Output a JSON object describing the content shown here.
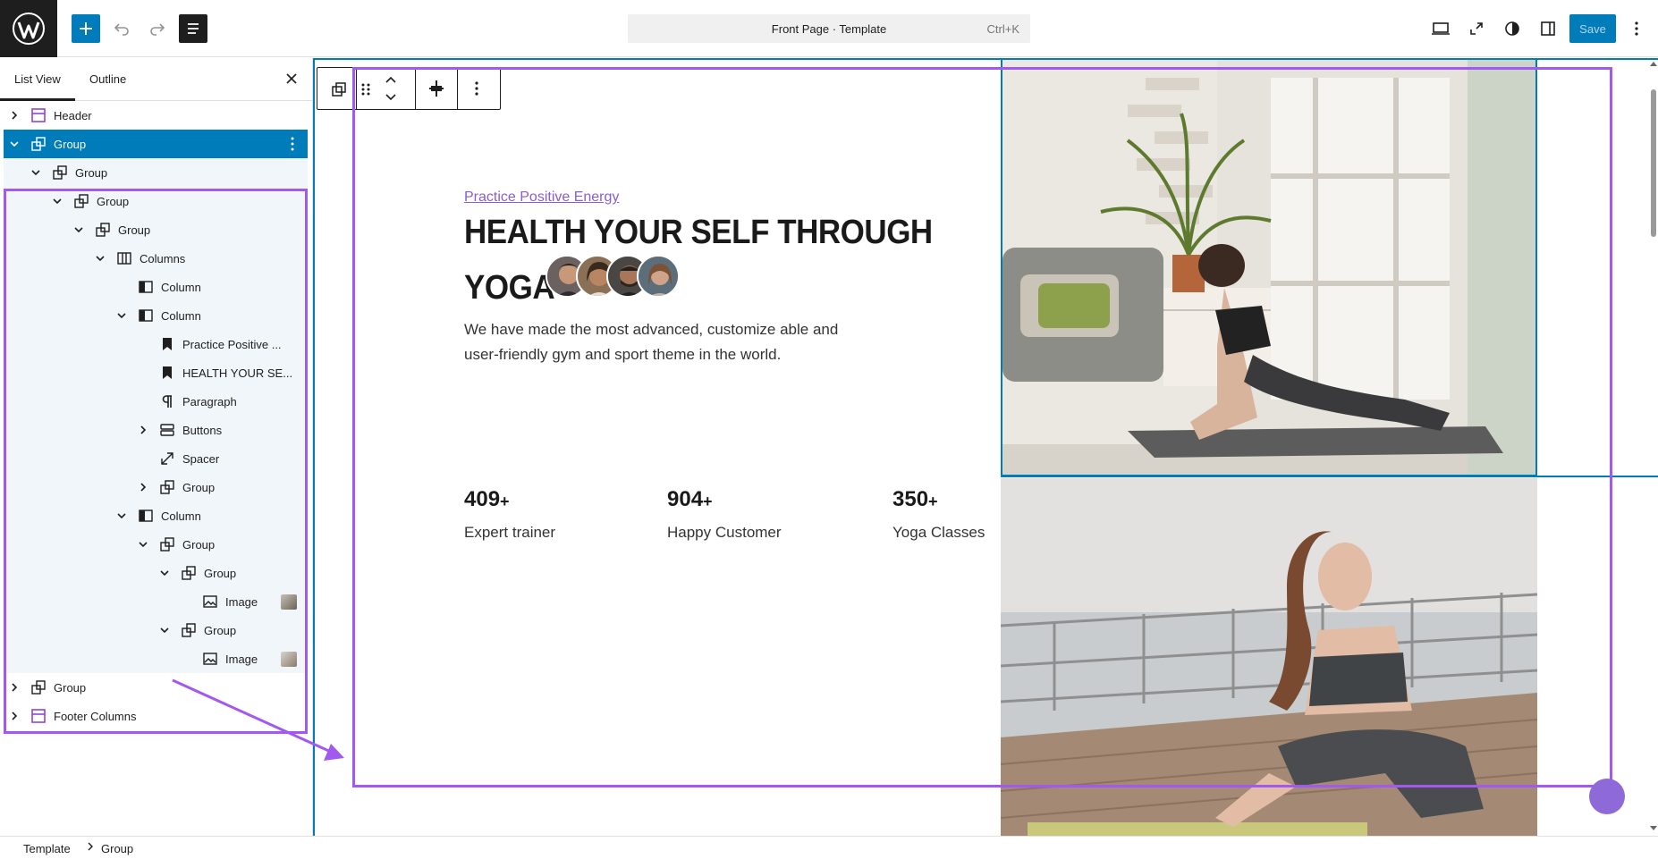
{
  "topbar": {
    "command_label": "Front Page · Template",
    "command_shortcut": "Ctrl+K",
    "save_label": "Save"
  },
  "sidebar": {
    "tabs": [
      "List View",
      "Outline"
    ],
    "rows": [
      {
        "label": "Header",
        "icon": "template-part-icon",
        "expander": "right"
      },
      {
        "label": "Group",
        "icon": "group-icon",
        "expander": "down"
      },
      {
        "label": "Group",
        "icon": "group-icon",
        "expander": "down"
      },
      {
        "label": "Group",
        "icon": "group-icon",
        "expander": "down"
      },
      {
        "label": "Group",
        "icon": "group-icon",
        "expander": "down"
      },
      {
        "label": "Columns",
        "icon": "columns-icon",
        "expander": "down"
      },
      {
        "label": "Column",
        "icon": "column-icon",
        "expander": "none"
      },
      {
        "label": "Column",
        "icon": "column-icon",
        "expander": "down"
      },
      {
        "label": "Practice Positive ...",
        "icon": "bookmark-icon",
        "expander": "none"
      },
      {
        "label": "HEALTH YOUR SE...",
        "icon": "bookmark-icon",
        "expander": "none"
      },
      {
        "label": "Paragraph",
        "icon": "paragraph-icon",
        "expander": "none"
      },
      {
        "label": "Buttons",
        "icon": "buttons-icon",
        "expander": "right"
      },
      {
        "label": "Spacer",
        "icon": "spacer-icon",
        "expander": "none"
      },
      {
        "label": "Group",
        "icon": "group-icon",
        "expander": "right"
      },
      {
        "label": "Column",
        "icon": "column-icon",
        "expander": "down"
      },
      {
        "label": "Group",
        "icon": "group-icon",
        "expander": "down"
      },
      {
        "label": "Group",
        "icon": "group-icon",
        "expander": "down"
      },
      {
        "label": "Image",
        "icon": "image-icon",
        "expander": "none"
      },
      {
        "label": "Group",
        "icon": "group-icon",
        "expander": "down"
      },
      {
        "label": "Image",
        "icon": "image-icon",
        "expander": "none"
      },
      {
        "label": "Group",
        "icon": "group-icon",
        "expander": "right"
      },
      {
        "label": "Footer Columns",
        "icon": "template-part-icon",
        "expander": "right"
      }
    ]
  },
  "canvas": {
    "tagline": "Practice Positive Energy",
    "heading_line1": "HEALTH YOUR SELF THROUGH",
    "heading_line2": "YOGA",
    "description": "We have made the most advanced, customize able and user-friendly gym and sport theme in the world.",
    "stats": [
      {
        "value": "409",
        "suffix": "+",
        "label": "Expert trainer"
      },
      {
        "value": "904",
        "suffix": "+",
        "label": "Happy Customer"
      },
      {
        "value": "350",
        "suffix": "+",
        "label": "Yoga Classes"
      }
    ]
  },
  "breadcrumb": [
    "Template",
    "Group"
  ],
  "colors": {
    "accent": "#007cba",
    "highlight": "#a259f0",
    "tagline": "#8b5dce"
  }
}
